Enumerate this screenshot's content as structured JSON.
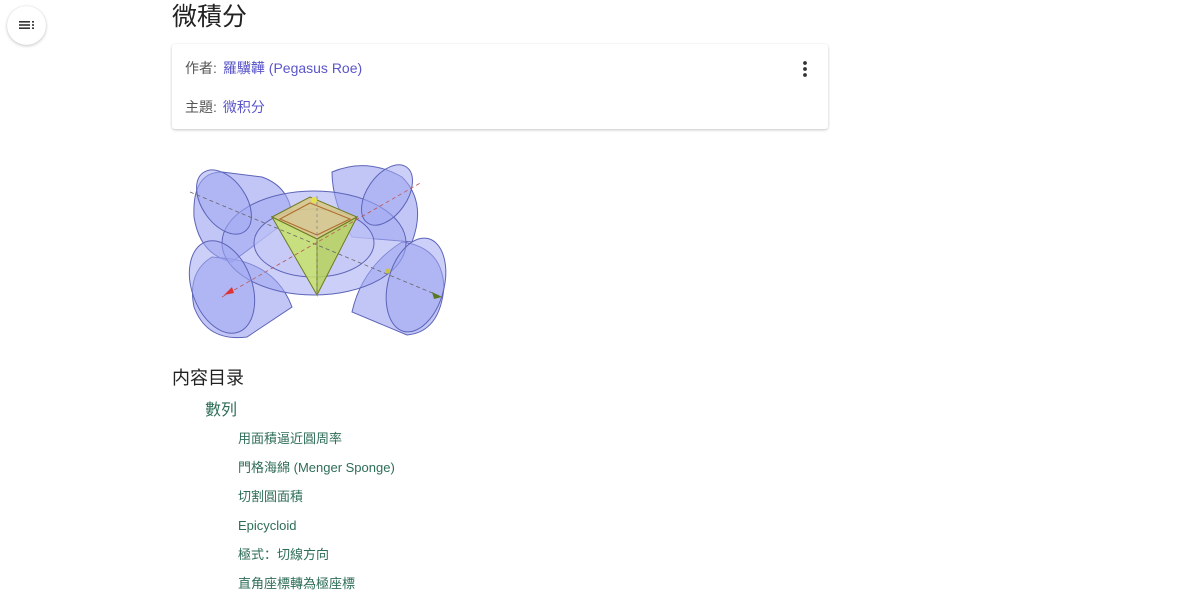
{
  "page": {
    "title": "微積分"
  },
  "info_card": {
    "author_label": "作者:",
    "author_name": "羅驥韡 (Pegasus Roe)",
    "topic_label": "主題:",
    "topic_name": "微积分"
  },
  "toc": {
    "heading": "内容目录",
    "section_title": "數列",
    "items": [
      "用面積逼近圓周率",
      "門格海綿 (Menger Sponge)",
      "切割圓面積",
      "Epicycloid",
      "極式：切線方向",
      "直角座標轉為極座標"
    ]
  },
  "icons": {
    "menu": "menu-list-icon",
    "more": "more-vert-icon"
  },
  "colors": {
    "link": "#5a55c9",
    "toc_link": "#2e6d58",
    "cylinder_fill": "#8f98ee",
    "solid_fill": "#c8e36a"
  }
}
